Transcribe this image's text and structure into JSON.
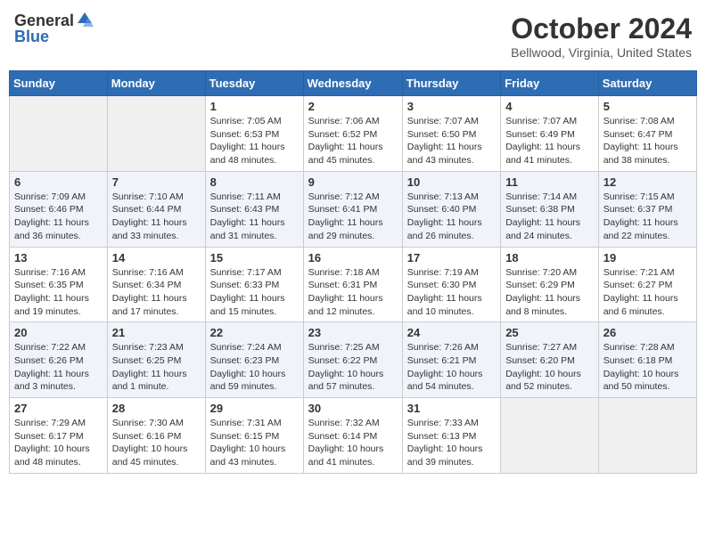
{
  "header": {
    "logo_general": "General",
    "logo_blue": "Blue",
    "title": "October 2024",
    "subtitle": "Bellwood, Virginia, United States"
  },
  "weekdays": [
    "Sunday",
    "Monday",
    "Tuesday",
    "Wednesday",
    "Thursday",
    "Friday",
    "Saturday"
  ],
  "weeks": [
    [
      {
        "day": "",
        "info": ""
      },
      {
        "day": "",
        "info": ""
      },
      {
        "day": "1",
        "info": "Sunrise: 7:05 AM\nSunset: 6:53 PM\nDaylight: 11 hours and 48 minutes."
      },
      {
        "day": "2",
        "info": "Sunrise: 7:06 AM\nSunset: 6:52 PM\nDaylight: 11 hours and 45 minutes."
      },
      {
        "day": "3",
        "info": "Sunrise: 7:07 AM\nSunset: 6:50 PM\nDaylight: 11 hours and 43 minutes."
      },
      {
        "day": "4",
        "info": "Sunrise: 7:07 AM\nSunset: 6:49 PM\nDaylight: 11 hours and 41 minutes."
      },
      {
        "day": "5",
        "info": "Sunrise: 7:08 AM\nSunset: 6:47 PM\nDaylight: 11 hours and 38 minutes."
      }
    ],
    [
      {
        "day": "6",
        "info": "Sunrise: 7:09 AM\nSunset: 6:46 PM\nDaylight: 11 hours and 36 minutes."
      },
      {
        "day": "7",
        "info": "Sunrise: 7:10 AM\nSunset: 6:44 PM\nDaylight: 11 hours and 33 minutes."
      },
      {
        "day": "8",
        "info": "Sunrise: 7:11 AM\nSunset: 6:43 PM\nDaylight: 11 hours and 31 minutes."
      },
      {
        "day": "9",
        "info": "Sunrise: 7:12 AM\nSunset: 6:41 PM\nDaylight: 11 hours and 29 minutes."
      },
      {
        "day": "10",
        "info": "Sunrise: 7:13 AM\nSunset: 6:40 PM\nDaylight: 11 hours and 26 minutes."
      },
      {
        "day": "11",
        "info": "Sunrise: 7:14 AM\nSunset: 6:38 PM\nDaylight: 11 hours and 24 minutes."
      },
      {
        "day": "12",
        "info": "Sunrise: 7:15 AM\nSunset: 6:37 PM\nDaylight: 11 hours and 22 minutes."
      }
    ],
    [
      {
        "day": "13",
        "info": "Sunrise: 7:16 AM\nSunset: 6:35 PM\nDaylight: 11 hours and 19 minutes."
      },
      {
        "day": "14",
        "info": "Sunrise: 7:16 AM\nSunset: 6:34 PM\nDaylight: 11 hours and 17 minutes."
      },
      {
        "day": "15",
        "info": "Sunrise: 7:17 AM\nSunset: 6:33 PM\nDaylight: 11 hours and 15 minutes."
      },
      {
        "day": "16",
        "info": "Sunrise: 7:18 AM\nSunset: 6:31 PM\nDaylight: 11 hours and 12 minutes."
      },
      {
        "day": "17",
        "info": "Sunrise: 7:19 AM\nSunset: 6:30 PM\nDaylight: 11 hours and 10 minutes."
      },
      {
        "day": "18",
        "info": "Sunrise: 7:20 AM\nSunset: 6:29 PM\nDaylight: 11 hours and 8 minutes."
      },
      {
        "day": "19",
        "info": "Sunrise: 7:21 AM\nSunset: 6:27 PM\nDaylight: 11 hours and 6 minutes."
      }
    ],
    [
      {
        "day": "20",
        "info": "Sunrise: 7:22 AM\nSunset: 6:26 PM\nDaylight: 11 hours and 3 minutes."
      },
      {
        "day": "21",
        "info": "Sunrise: 7:23 AM\nSunset: 6:25 PM\nDaylight: 11 hours and 1 minute."
      },
      {
        "day": "22",
        "info": "Sunrise: 7:24 AM\nSunset: 6:23 PM\nDaylight: 10 hours and 59 minutes."
      },
      {
        "day": "23",
        "info": "Sunrise: 7:25 AM\nSunset: 6:22 PM\nDaylight: 10 hours and 57 minutes."
      },
      {
        "day": "24",
        "info": "Sunrise: 7:26 AM\nSunset: 6:21 PM\nDaylight: 10 hours and 54 minutes."
      },
      {
        "day": "25",
        "info": "Sunrise: 7:27 AM\nSunset: 6:20 PM\nDaylight: 10 hours and 52 minutes."
      },
      {
        "day": "26",
        "info": "Sunrise: 7:28 AM\nSunset: 6:18 PM\nDaylight: 10 hours and 50 minutes."
      }
    ],
    [
      {
        "day": "27",
        "info": "Sunrise: 7:29 AM\nSunset: 6:17 PM\nDaylight: 10 hours and 48 minutes."
      },
      {
        "day": "28",
        "info": "Sunrise: 7:30 AM\nSunset: 6:16 PM\nDaylight: 10 hours and 45 minutes."
      },
      {
        "day": "29",
        "info": "Sunrise: 7:31 AM\nSunset: 6:15 PM\nDaylight: 10 hours and 43 minutes."
      },
      {
        "day": "30",
        "info": "Sunrise: 7:32 AM\nSunset: 6:14 PM\nDaylight: 10 hours and 41 minutes."
      },
      {
        "day": "31",
        "info": "Sunrise: 7:33 AM\nSunset: 6:13 PM\nDaylight: 10 hours and 39 minutes."
      },
      {
        "day": "",
        "info": ""
      },
      {
        "day": "",
        "info": ""
      }
    ]
  ]
}
